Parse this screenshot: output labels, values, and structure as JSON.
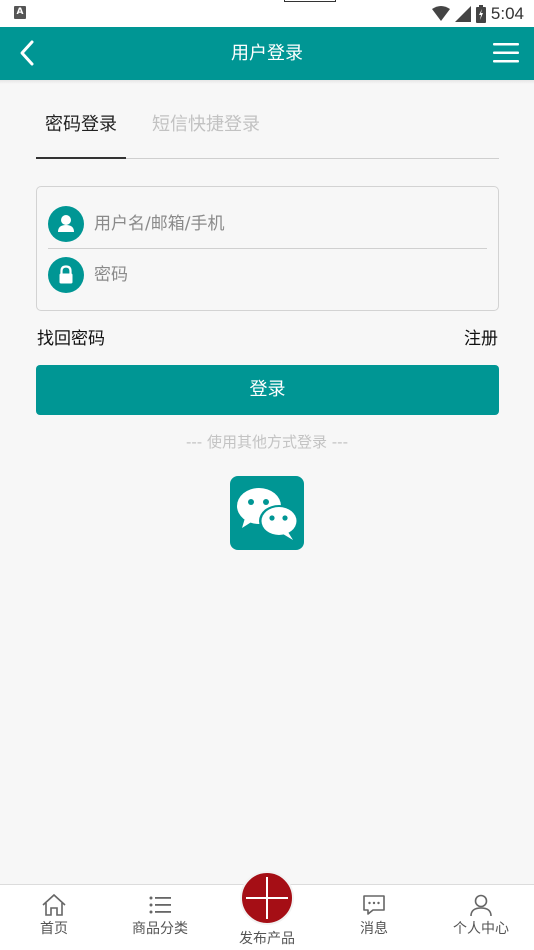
{
  "status_bar": {
    "left_badge": "A",
    "time": "5:04"
  },
  "header": {
    "title": "用户登录",
    "back_icon": "chevron-left-icon",
    "menu_icon": "hamburger-menu-icon"
  },
  "tabs": [
    {
      "label": "密码登录",
      "active": true
    },
    {
      "label": "短信快捷登录",
      "active": false
    }
  ],
  "form": {
    "username": {
      "placeholder": "用户名/邮箱/手机",
      "value": "",
      "icon": "user-icon"
    },
    "password": {
      "placeholder": "密码",
      "value": "",
      "icon": "lock-icon"
    }
  },
  "links": {
    "forgot": "找回密码",
    "register": "注册"
  },
  "login_button": "登录",
  "other_methods": "--- 使用其他方式登录 ---",
  "social": {
    "wechat_icon": "wechat-icon"
  },
  "bottom_nav": [
    {
      "label": "首页",
      "icon": "home-icon"
    },
    {
      "label": "商品分类",
      "icon": "list-icon"
    },
    {
      "label": "发布产品",
      "icon": "plus-icon"
    },
    {
      "label": "消息",
      "icon": "message-icon"
    },
    {
      "label": "个人中心",
      "icon": "person-icon"
    }
  ],
  "colors": {
    "primary": "#009694",
    "publish": "#a50e15",
    "background": "#f7f7f7"
  }
}
